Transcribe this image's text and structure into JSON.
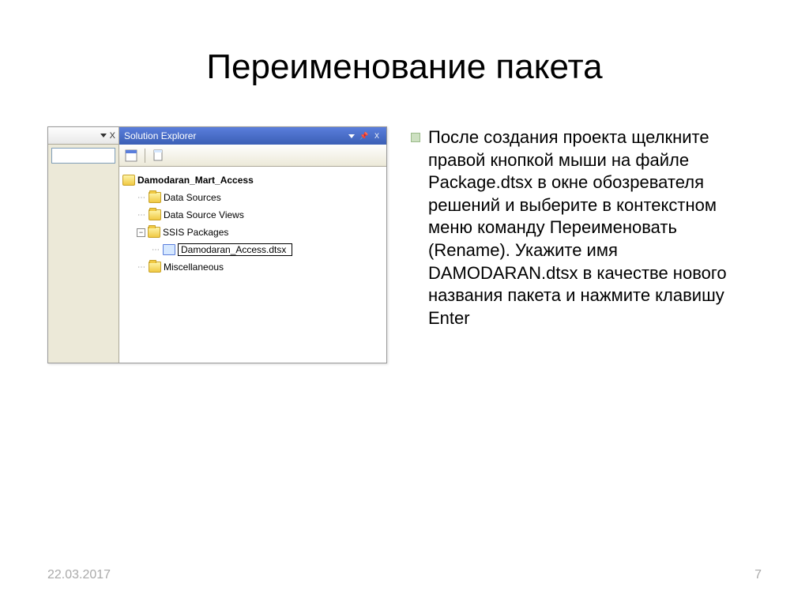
{
  "slide": {
    "title": "Переименование пакета",
    "body": "После создания проекта щелкните правой кнопкой мыши на файле Package.dtsx в окне обозревателя решений и выберите в контекстном меню команду Переименовать (Rename). Укажите имя DAMODARAN.dtsx в качестве нового названия пакета и нажмите клавишу Enter",
    "date": "22.03.2017",
    "page": "7"
  },
  "explorer": {
    "title": "Solution Explorer",
    "left_header_close": "X",
    "pin": "▾",
    "titlebar_close": "X",
    "project": "Damodaran_Mart_Access",
    "nodes": {
      "data_sources": "Data Sources",
      "data_source_views": "Data Source Views",
      "ssis_packages": "SSIS Packages",
      "miscellaneous": "Miscellaneous"
    },
    "rename_value": "Damodaran_Access.dtsx",
    "expand_minus": "−"
  }
}
